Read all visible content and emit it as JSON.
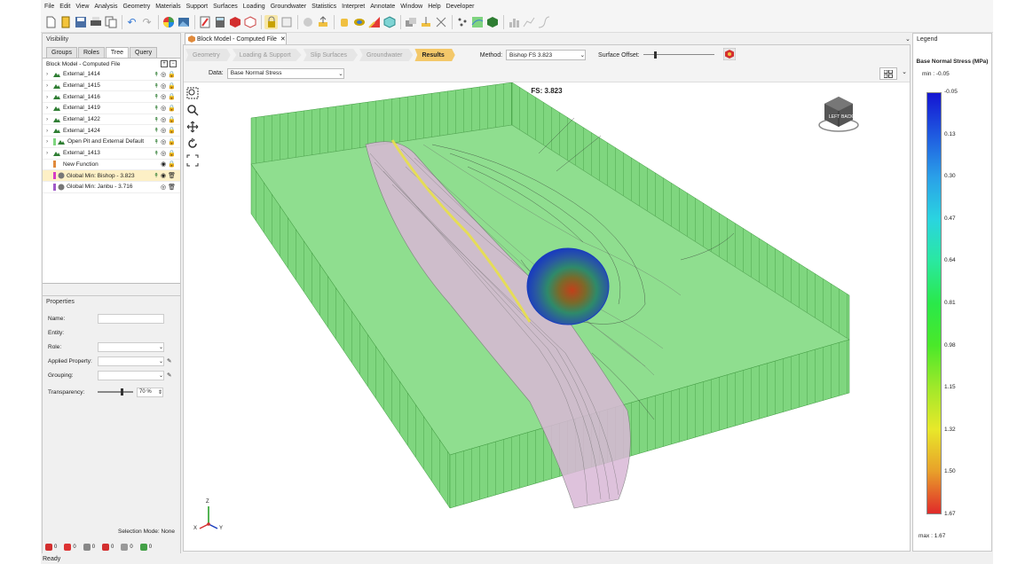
{
  "menu": [
    "File",
    "Edit",
    "View",
    "Analysis",
    "Geometry",
    "Materials",
    "Support",
    "Surfaces",
    "Loading",
    "Groundwater",
    "Statistics",
    "Interpret",
    "Annotate",
    "Window",
    "Help",
    "Developer"
  ],
  "visibility": {
    "title": "Visibility",
    "tabs": [
      "Groups",
      "Roles",
      "Tree",
      "Query"
    ],
    "active_tab": "Tree",
    "tree_root": "Block Model - Computed File",
    "items": [
      {
        "label": "External_1414",
        "color": "#2e7d32",
        "expandable": true
      },
      {
        "label": "External_1415",
        "color": "#2e7d32",
        "expandable": true
      },
      {
        "label": "External_1416",
        "color": "#2e7d32",
        "expandable": true
      },
      {
        "label": "External_1419",
        "color": "#2e7d32",
        "expandable": true
      },
      {
        "label": "External_1422",
        "color": "#2e7d32",
        "expandable": true
      },
      {
        "label": "External_1424",
        "color": "#2e7d32",
        "expandable": true
      },
      {
        "label": "Open Pit and External Default",
        "color": "#2e7d32",
        "expandable": true
      },
      {
        "label": "External_1413",
        "color": "#2e7d32",
        "expandable": true
      },
      {
        "label": "New Function",
        "color": "#e08a3c",
        "expandable": false
      },
      {
        "label": "Global Min: Bishop  -  3.823",
        "color": "#d63cc6",
        "expandable": false
      },
      {
        "label": "Global Min: Janbu  -  3.716",
        "color": "#a05ac8",
        "expandable": false
      }
    ]
  },
  "properties": {
    "title": "Properties",
    "name_label": "Name:",
    "entity_label": "Entity:",
    "role_label": "Role:",
    "applied_label": "Applied Property:",
    "grouping_label": "Grouping:",
    "transparency_label": "Transparency:",
    "transparency_value": "70 %",
    "transparency_fraction": 0.7,
    "selection_mode": "Selection Mode: None"
  },
  "status_counts": [
    "0",
    "0",
    "0",
    "0",
    "0",
    "0"
  ],
  "status": "Ready",
  "document": {
    "tab_title": "Block Model - Computed File",
    "steps": [
      "Geometry",
      "Loading & Support",
      "Slip Surfaces",
      "Groundwater",
      "Results"
    ],
    "active_step": "Results",
    "method_label": "Method:",
    "method_value": "Bishop FS  3.823",
    "offset_label": "Surface Offset:",
    "data_label": "Data:",
    "data_value": "Base Normal Stress",
    "fs_title": "FS: 3.823"
  },
  "axis": {
    "z": "Z",
    "x": "X",
    "y": "Y"
  },
  "legend": {
    "title": "Legend",
    "heading": "Base Normal Stress (MPa)",
    "min": "min : -0.05",
    "max": "max : 1.67",
    "ticks": [
      "-0.05",
      "0.13",
      "0.30",
      "0.47",
      "0.64",
      "0.81",
      "0.98",
      "1.15",
      "1.32",
      "1.50",
      "1.67"
    ]
  }
}
